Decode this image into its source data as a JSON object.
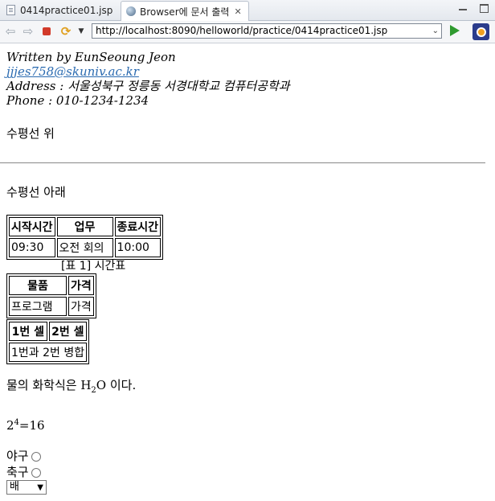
{
  "tabs": [
    {
      "label": "0414practice01.jsp"
    },
    {
      "label": "Browser에 문서 출력"
    }
  ],
  "toolbar": {
    "url": "http://localhost:8090/helloworld/practice/0414practice01.jsp"
  },
  "page": {
    "written_by": "Written by EunSeoung Jeon",
    "email": "jjjes758@skuniv.ac.kr",
    "address": "Address : 서울성북구 정릉동 서경대학교 컴퓨터공학과",
    "phone": "Phone : 010-1234-1234",
    "above_hr": "수평선 위",
    "below_hr": "수평선 아래",
    "schedule_table": {
      "headers": [
        "시작시간",
        "업무",
        "종료시간"
      ],
      "rows": [
        [
          "09:30",
          "오전 회의",
          "10:00"
        ]
      ],
      "caption": "[표 1] 시간표"
    },
    "product_table": {
      "headers": [
        "물품",
        "가격"
      ],
      "rows": [
        [
          "프로그램",
          "가격"
        ]
      ]
    },
    "cell_table": {
      "headers": [
        "1번 셀",
        "2번 셀"
      ],
      "merged": "1번과 2번 병합"
    },
    "water_prefix": "물의 화학식은 H",
    "water_sub": "2",
    "water_suffix": "O 이다.",
    "power_base": "2",
    "power_exp": "4",
    "power_result": "=16",
    "radio_baseball": "야구",
    "radio_soccer": "축구",
    "select_value": "배"
  }
}
